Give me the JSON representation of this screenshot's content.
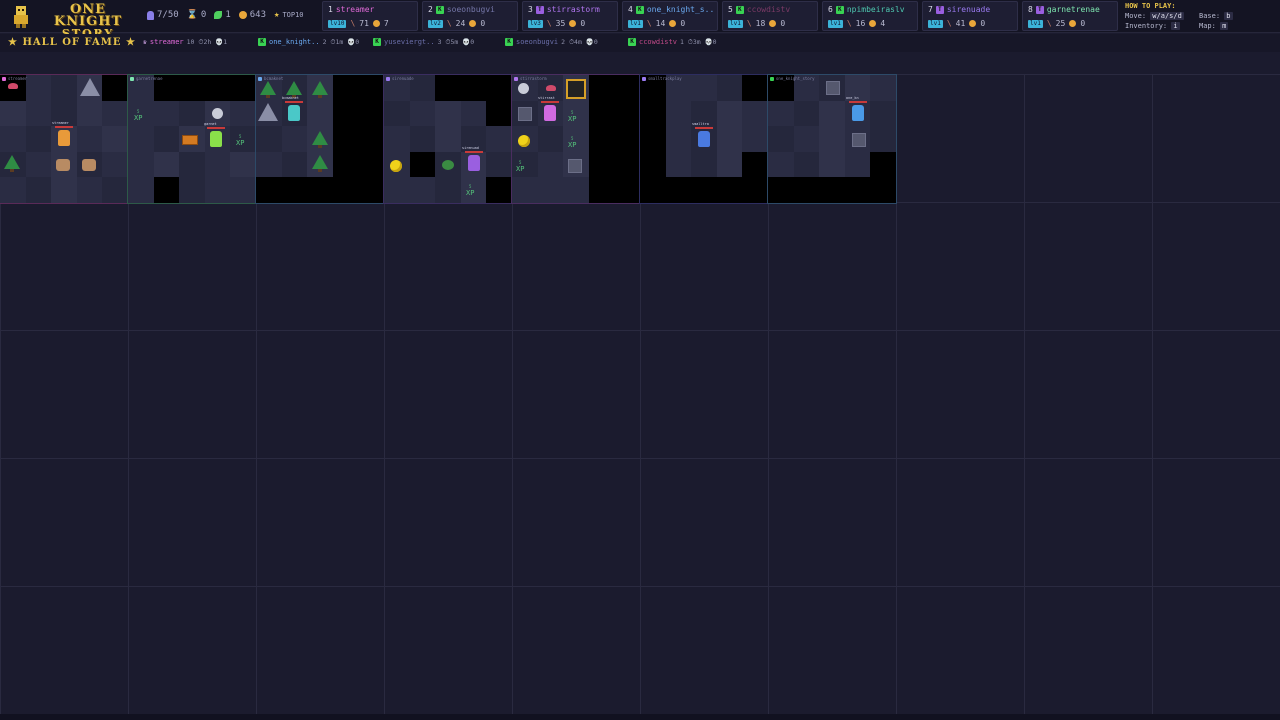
{
  "game": {
    "title_line1": "ONE KNIGHT",
    "title_line2": "STORY"
  },
  "stats": {
    "players": "7/50",
    "time": "0",
    "harvest": "1",
    "gold": "643",
    "top": "TOP10"
  },
  "leaderboard": [
    {
      "rank": "1",
      "name": "streamer",
      "class": "",
      "class_color": "",
      "name_color": "#e06ad8",
      "level": "lv10",
      "kills": "71",
      "coins": "7"
    },
    {
      "rank": "2",
      "name": "soeonbugvi",
      "class": "K",
      "class_color": "#39d353",
      "name_color": "#7476a8",
      "level": "lv2",
      "kills": "24",
      "coins": "0"
    },
    {
      "rank": "3",
      "name": "stirrastorm",
      "class": "T",
      "class_color": "#9a5fe0",
      "name_color": "#b176f0",
      "level": "lv3",
      "kills": "35",
      "coins": "0"
    },
    {
      "rank": "4",
      "name": "one_knight_s..",
      "class": "K",
      "class_color": "#39d353",
      "name_color": "#6aa8ee",
      "level": "lv1",
      "kills": "14",
      "coins": "0"
    },
    {
      "rank": "5",
      "name": "ccowdistv",
      "class": "K",
      "class_color": "#39d353",
      "name_color": "#7b3a66",
      "level": "lv1",
      "kills": "18",
      "coins": "0"
    },
    {
      "rank": "6",
      "name": "npimbeiraslv",
      "class": "K",
      "class_color": "#39d353",
      "name_color": "#4ec8b0",
      "level": "lv1",
      "kills": "16",
      "coins": "4"
    },
    {
      "rank": "7",
      "name": "sirenuade",
      "class": "T",
      "class_color": "#9a5fe0",
      "name_color": "#9a7af0",
      "level": "lv1",
      "kills": "41",
      "coins": "0"
    },
    {
      "rank": "8",
      "name": "garnetrenae",
      "class": "T",
      "class_color": "#9a5fe0",
      "name_color": "#7ee6b0",
      "level": "lv1",
      "kills": "25",
      "coins": "0"
    }
  ],
  "how_to_play": {
    "title": "HOW TO PLAY:",
    "move_label": "Move:",
    "move_key": "w/a/s/d",
    "base_label": "Base:",
    "base_key": "b",
    "inventory_label": "Inventory:",
    "inventory_key": "i",
    "map_label": "Map:",
    "map_key": "m"
  },
  "hall_of_fame": {
    "title": "HALL OF FAME",
    "entries": [
      {
        "name": "streamer",
        "class": "",
        "class_color": "",
        "name_color": "#e06ad8",
        "detail": "10 ⏱2h 💀1"
      },
      {
        "name": "one_knight..",
        "class": "K",
        "class_color": "#39d353",
        "name_color": "#6aa8ee",
        "detail": "2 ⏱1m 💀0"
      },
      {
        "name": "yuseviergt..",
        "class": "K",
        "class_color": "#39d353",
        "name_color": "#6a6ea8",
        "detail": "3 ⏱5m 💀0"
      },
      {
        "name": "soeonbugvi",
        "class": "K",
        "class_color": "#39d353",
        "name_color": "#6a6ea8",
        "detail": "2 ⏱4m 💀0"
      },
      {
        "name": "ccowdistv",
        "class": "K",
        "class_color": "#39d353",
        "name_color": "#c04a88",
        "detail": "1 ⏱3m 💀0"
      }
    ]
  },
  "regions": [
    {
      "name": "streamer",
      "dot": "#e06ad8",
      "frame": "#5a2a58"
    },
    {
      "name": "garnetrenae",
      "dot": "#7ee6b0",
      "frame": "#2d5a48"
    },
    {
      "name": "bcmaknet",
      "dot": "#6aa8ee",
      "frame": "#2d4a68"
    },
    {
      "name": "sirenuade",
      "dot": "#9a7af0",
      "frame": "#3a2d60"
    },
    {
      "name": "stirrastorm",
      "dot": "#b176f0",
      "frame": "#4a2d60"
    },
    {
      "name": "smalltrackplay",
      "dot": "#9a7af0",
      "frame": "#2d2d60"
    },
    {
      "name": "one_knight_story",
      "dot": "#39d353",
      "frame": "#2d4a68"
    }
  ],
  "map_labels": {
    "xp": "XP",
    "xp_small_1": "5",
    "xp_small_2": "15",
    "xp_small_3": "7",
    "hero_streamer": "streamer",
    "hero_garnet": "garnet",
    "hero_bcm": "bcmaknet",
    "hero_siren": "sirenuad",
    "hero_stirra": "stirrast",
    "hero_small": "smalltra",
    "hero_oneknight": "one_kn"
  }
}
